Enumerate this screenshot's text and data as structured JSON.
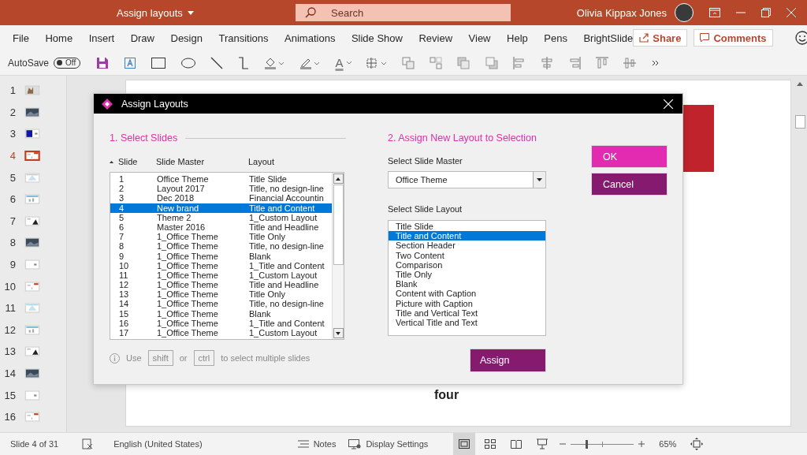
{
  "title_bar": {
    "document_title": "Assign layouts",
    "search_placeholder": "Search",
    "user_name": "Olivia Kippax Jones"
  },
  "ribbon_tabs": [
    "File",
    "Home",
    "Insert",
    "Draw",
    "Design",
    "Transitions",
    "Animations",
    "Slide Show",
    "Review",
    "View",
    "Help",
    "Pens",
    "BrightSlide"
  ],
  "share_button": "Share",
  "comments_button": "Comments",
  "toolbar": {
    "autosave_label": "AutoSave",
    "autosave_state": "Off",
    "autosave_on": false,
    "font_color_glyph": "A"
  },
  "thumbnails": [
    {
      "number": "1",
      "kind": "photo",
      "selected": false
    },
    {
      "number": "2",
      "kind": "dark",
      "selected": false
    },
    {
      "number": "3",
      "kind": "block",
      "selected": false
    },
    {
      "number": "4",
      "kind": "title",
      "selected": true
    },
    {
      "number": "5",
      "kind": "diagram",
      "selected": false
    },
    {
      "number": "6",
      "kind": "chart",
      "selected": false
    },
    {
      "number": "7",
      "kind": "mountain",
      "selected": false
    },
    {
      "number": "8",
      "kind": "dark",
      "selected": false
    },
    {
      "number": "9",
      "kind": "plain",
      "selected": false
    },
    {
      "number": "10",
      "kind": "title",
      "selected": false
    },
    {
      "number": "11",
      "kind": "diagram",
      "selected": false
    },
    {
      "number": "12",
      "kind": "chart",
      "selected": false
    },
    {
      "number": "13",
      "kind": "mountain",
      "selected": false
    },
    {
      "number": "14",
      "kind": "dark",
      "selected": false
    },
    {
      "number": "15",
      "kind": "plain",
      "selected": false
    },
    {
      "number": "16",
      "kind": "title",
      "selected": false
    }
  ],
  "slide": {
    "text": "four"
  },
  "dialog": {
    "title": "Assign Layouts",
    "section_1": "1. Select Slides",
    "columns": [
      "Slide",
      "Slide Master",
      "Layout"
    ],
    "rows": [
      {
        "slide": "1",
        "master": "Office Theme",
        "layout": "Title Slide",
        "selected": false
      },
      {
        "slide": "2",
        "master": "Layout 2017",
        "layout": "Title, no design-line",
        "selected": false
      },
      {
        "slide": "3",
        "master": "Dec 2018",
        "layout": "Financial Accountin",
        "selected": false
      },
      {
        "slide": "4",
        "master": "New brand",
        "layout": "Title and Content",
        "selected": true
      },
      {
        "slide": "5",
        "master": "Theme 2",
        "layout": "1_Custom Layout",
        "selected": false
      },
      {
        "slide": "6",
        "master": "Master 2016",
        "layout": "Title and Headline",
        "selected": false
      },
      {
        "slide": "7",
        "master": "1_Office Theme",
        "layout": "Title Only",
        "selected": false
      },
      {
        "slide": "8",
        "master": "1_Office Theme",
        "layout": "Title, no design-line",
        "selected": false
      },
      {
        "slide": "9",
        "master": "1_Office Theme",
        "layout": "Blank",
        "selected": false
      },
      {
        "slide": "10",
        "master": "1_Office Theme",
        "layout": "1_Title and Content",
        "selected": false
      },
      {
        "slide": "11",
        "master": "1_Office Theme",
        "layout": "1_Custom Layout",
        "selected": false
      },
      {
        "slide": "12",
        "master": "1_Office Theme",
        "layout": "Title and Headline",
        "selected": false
      },
      {
        "slide": "13",
        "master": "1_Office Theme",
        "layout": "Title Only",
        "selected": false
      },
      {
        "slide": "14",
        "master": "1_Office Theme",
        "layout": "Title, no design-line",
        "selected": false
      },
      {
        "slide": "15",
        "master": "1_Office Theme",
        "layout": "Blank",
        "selected": false
      },
      {
        "slide": "16",
        "master": "1_Office Theme",
        "layout": "1_Title and Content",
        "selected": false
      },
      {
        "slide": "17",
        "master": "1_Office Theme",
        "layout": "1_Custom Layout",
        "selected": false
      }
    ],
    "hint": {
      "use": "Use",
      "key_1": "shift",
      "or": "or",
      "key_2": "ctrl",
      "rest": "to select multiple slides"
    },
    "section_2": "2. Assign New Layout to Selection",
    "master_label": "Select Slide Master",
    "master_value": "Office Theme",
    "layout_label": "Select Slide Layout",
    "layouts": [
      {
        "label": "Title Slide",
        "selected": false
      },
      {
        "label": "Title and Content",
        "selected": true
      },
      {
        "label": "Section Header",
        "selected": false
      },
      {
        "label": "Two Content",
        "selected": false
      },
      {
        "label": "Comparison",
        "selected": false
      },
      {
        "label": "Title Only",
        "selected": false
      },
      {
        "label": "Blank",
        "selected": false
      },
      {
        "label": "Content with Caption",
        "selected": false
      },
      {
        "label": "Picture with Caption",
        "selected": false
      },
      {
        "label": "Title and Vertical Text",
        "selected": false
      },
      {
        "label": "Vertical Title and Text",
        "selected": false
      }
    ],
    "ok_button": "OK",
    "cancel_button": "Cancel",
    "assign_button": "Assign"
  },
  "status_bar": {
    "slide_info": "Slide 4 of 31",
    "language": "English (United States)",
    "notes": "Notes",
    "display_settings": "Display Settings",
    "zoom": "65%",
    "zoom_slider": {
      "level": 0.25
    }
  }
}
